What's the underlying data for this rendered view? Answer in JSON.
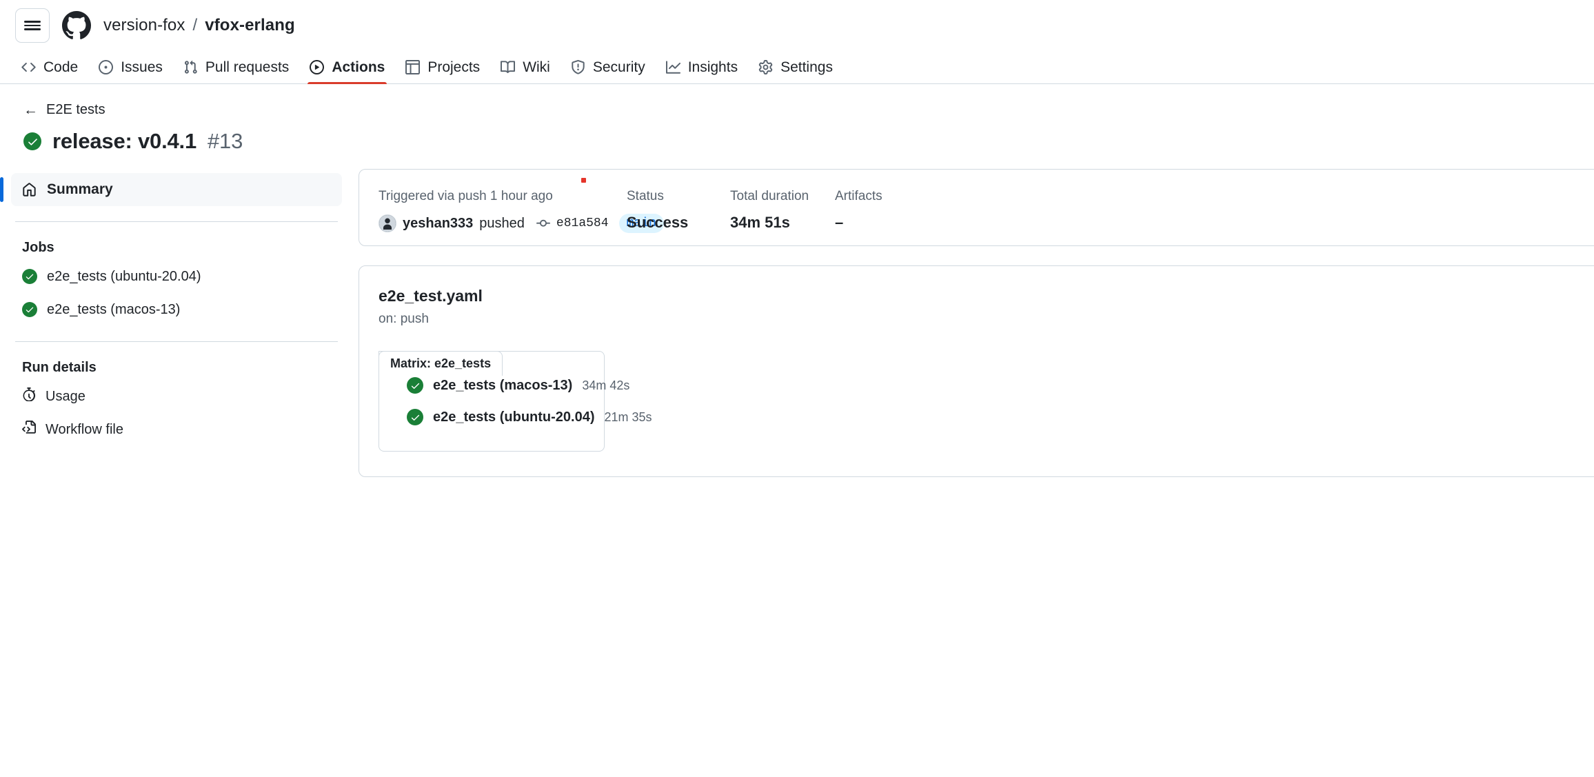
{
  "header": {
    "menu_label": "Open menu",
    "logo": "github-octocat-logo",
    "breadcrumb": {
      "owner": "version-fox",
      "separator": "/",
      "repo": "vfox-erlang"
    }
  },
  "nav": {
    "tabs": [
      {
        "label": "Code",
        "icon": "code-icon",
        "active": false
      },
      {
        "label": "Issues",
        "icon": "issue-opened-icon",
        "active": false
      },
      {
        "label": "Pull requests",
        "icon": "git-pull-request-icon",
        "active": false
      },
      {
        "label": "Actions",
        "icon": "play-icon",
        "active": true
      },
      {
        "label": "Projects",
        "icon": "table-icon",
        "active": false
      },
      {
        "label": "Wiki",
        "icon": "book-icon",
        "active": false
      },
      {
        "label": "Security",
        "icon": "shield-icon",
        "active": false
      },
      {
        "label": "Insights",
        "icon": "graph-icon",
        "active": false
      },
      {
        "label": "Settings",
        "icon": "gear-icon",
        "active": false
      }
    ],
    "active_underline_color": "#d93b2b"
  },
  "run": {
    "back_label": "E2E tests",
    "back_icon": "arrow-left-icon",
    "status_icon": "check-circle-icon",
    "title": "release: v0.4.1",
    "number": "#13"
  },
  "sidebar": {
    "summary": {
      "label": "Summary",
      "icon": "home-icon"
    },
    "jobs_heading": "Jobs",
    "jobs": [
      {
        "label": "e2e_tests (ubuntu-20.04)",
        "status_icon": "check-circle-icon"
      },
      {
        "label": "e2e_tests (macos-13)",
        "status_icon": "check-circle-icon"
      }
    ],
    "run_details_heading": "Run details",
    "run_details": [
      {
        "label": "Usage",
        "icon": "stopwatch-icon"
      },
      {
        "label": "Workflow file",
        "icon": "file-code-icon"
      }
    ]
  },
  "summary_card": {
    "trigger_label": "Triggered via push 1 hour ago",
    "actor": "yeshan333",
    "action": "pushed",
    "commit_icon": "git-commit-icon",
    "commit_sha": "e81a584",
    "branch": "main",
    "status_label": "Status",
    "status_value": "Success",
    "duration_label": "Total duration",
    "duration_value": "34m 51s",
    "artifacts_label": "Artifacts",
    "artifacts_value": "–"
  },
  "workflow": {
    "file_name": "e2e_test.yaml",
    "trigger": "on: push",
    "matrix_label": "Matrix: e2e_tests",
    "matrix_jobs": [
      {
        "name": "e2e_tests (macos-13)",
        "duration": "34m 42s",
        "status_icon": "check-circle-icon"
      },
      {
        "name": "e2e_tests (ubuntu-20.04)",
        "duration": "21m 35s",
        "status_icon": "check-circle-icon"
      }
    ]
  },
  "colors": {
    "success_green": "#1a7f37",
    "accent_blue": "#0969da",
    "branch_badge_bg": "#ddf4ff",
    "border": "#d1d9e0",
    "muted_text": "#59636e",
    "marker_red": "#e5352b"
  }
}
